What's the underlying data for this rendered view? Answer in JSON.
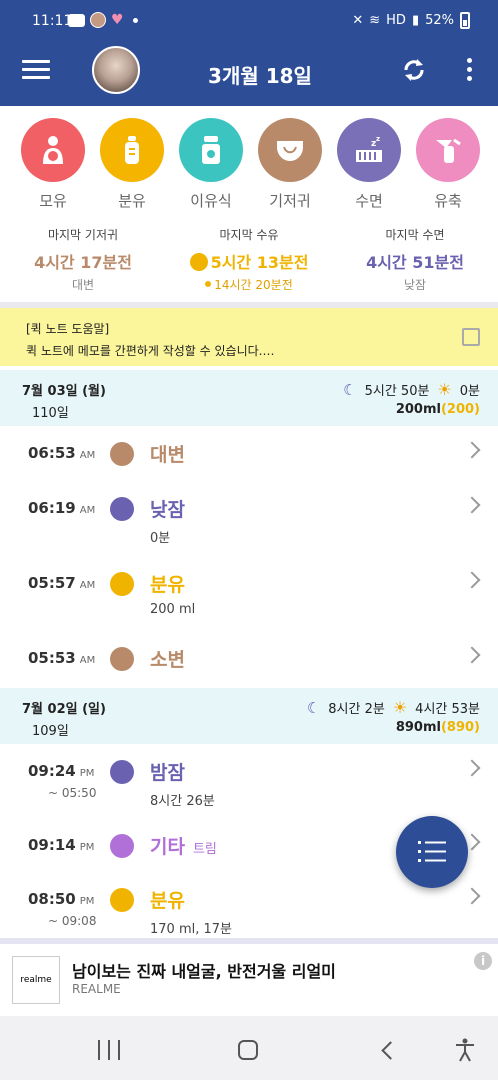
{
  "status_bar": {
    "time": "11:11",
    "battery": "52%",
    "network": "HD"
  },
  "app_bar": {
    "title": "3개월 18일"
  },
  "categories": [
    {
      "label": "모유",
      "color": "#f06064",
      "icon": "breastfeeding-icon"
    },
    {
      "label": "분유",
      "color": "#f5b400",
      "icon": "bottle-icon"
    },
    {
      "label": "이유식",
      "color": "#3cc5c0",
      "icon": "baby-food-icon"
    },
    {
      "label": "기저귀",
      "color": "#b88a6a",
      "icon": "diaper-icon"
    },
    {
      "label": "수면",
      "color": "#7a70b8",
      "icon": "sleep-icon"
    },
    {
      "label": "유축",
      "color": "#ef8cc0",
      "icon": "pump-icon"
    }
  ],
  "summary": {
    "diaper": {
      "title": "마지막 기저귀",
      "value": "4시간 17분전",
      "sub": "대변",
      "color": "#b88a6a"
    },
    "feeding": {
      "title": "마지막 수유",
      "value": "5시간 13분전",
      "sub": "14시간 20분전",
      "color": "#f0b400"
    },
    "sleep": {
      "title": "마지막 수면",
      "value": "4시간 51분전",
      "sub": "낮잠",
      "color": "#6a62b0"
    }
  },
  "quick_note": {
    "title": "[퀵 노트 도움말]",
    "text": "퀵 노트에 메모를 간편하게 작성할 수 있습니다.…"
  },
  "days": [
    {
      "date": "7월 03일 (월)",
      "age": "110일",
      "night_sleep": "5시간 50분",
      "day_sleep": "0분",
      "ml_total": "200ml",
      "ml_formula": "(200)",
      "entries": [
        {
          "time": "06:53",
          "ampm": "AM",
          "name": "대변",
          "type": "diaper",
          "color": "#b88a6a"
        },
        {
          "time": "06:19",
          "ampm": "AM",
          "name": "낮잠",
          "type": "sleep",
          "color": "#6a62b0",
          "detail": "0분"
        },
        {
          "time": "05:57",
          "ampm": "AM",
          "name": "분유",
          "type": "formula",
          "color": "#f0b400",
          "detail": "200 ml"
        },
        {
          "time": "05:53",
          "ampm": "AM",
          "name": "소변",
          "type": "diaper",
          "color": "#b88a6a"
        }
      ]
    },
    {
      "date": "7월 02일 (일)",
      "age": "109일",
      "night_sleep": "8시간 2분",
      "day_sleep": "4시간 53분",
      "ml_total": "890ml",
      "ml_formula": "(890)",
      "entries": [
        {
          "time": "09:24",
          "ampm": "PM",
          "end": "~ 05:50",
          "name": "밤잠",
          "type": "sleep",
          "color": "#6a62b0",
          "detail": "8시간 26분"
        },
        {
          "time": "09:14",
          "ampm": "PM",
          "name": "기타",
          "tag": "트림",
          "type": "other",
          "color": "#b070d8"
        },
        {
          "time": "08:50",
          "ampm": "PM",
          "end": "~ 09:08",
          "name": "분유",
          "type": "formula",
          "color": "#f0b400",
          "detail": "170 ml, 17분"
        }
      ]
    }
  ],
  "ad": {
    "title": "남이보는 진짜 내얼굴, 반전거울 리얼미",
    "brand": "REALME",
    "logo_text": "realme"
  }
}
